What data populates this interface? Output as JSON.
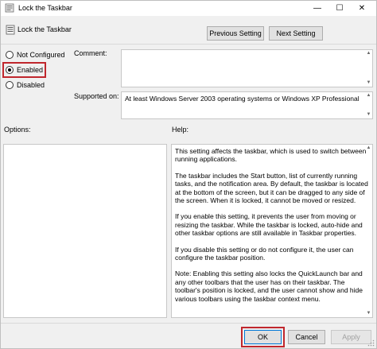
{
  "window": {
    "title": "Lock the Taskbar",
    "controls": {
      "minimize": "—",
      "maximize": "☐",
      "close": "✕"
    }
  },
  "header": {
    "title": "Lock the Taskbar",
    "previous_label": "Previous Setting",
    "next_label": "Next Setting"
  },
  "state": {
    "options": [
      {
        "label": "Not Configured",
        "selected": false
      },
      {
        "label": "Enabled",
        "selected": true
      },
      {
        "label": "Disabled",
        "selected": false
      }
    ]
  },
  "comment": {
    "label": "Comment:",
    "value": ""
  },
  "supported": {
    "label": "Supported on:",
    "value": "At least Windows Server 2003 operating systems or Windows XP Professional"
  },
  "options_panel": {
    "label": "Options:"
  },
  "help_panel": {
    "label": "Help:",
    "paragraphs": [
      "This setting affects the taskbar, which is used to switch between running applications.",
      "The taskbar includes the Start button, list of currently running tasks, and the notification area. By default, the taskbar is located at the bottom of the screen, but it can be dragged to any side of the screen. When it is locked, it cannot be moved or resized.",
      "If you enable this setting, it prevents the user from moving or resizing the taskbar. While the taskbar is locked, auto-hide and other taskbar options are still available in Taskbar properties.",
      "If you disable this setting or do not configure it, the user can configure the taskbar position.",
      "Note: Enabling this setting also locks the QuickLaunch bar and any other toolbars that the user has on their taskbar. The toolbar's position is locked, and the user cannot show and hide various toolbars using the taskbar context menu."
    ]
  },
  "footer": {
    "ok_label": "OK",
    "cancel_label": "Cancel",
    "apply_label": "Apply"
  },
  "colors": {
    "highlight": "#c0272d",
    "window_bg": "#f0f0f0",
    "focus_border": "#0078d7"
  },
  "icons": {
    "title": "policy-document-icon",
    "header": "policy-setting-icon"
  }
}
